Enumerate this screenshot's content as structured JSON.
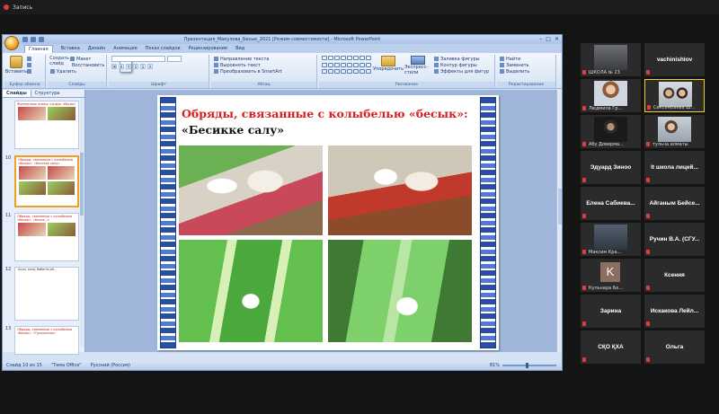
{
  "recording": {
    "label": "Запись"
  },
  "ppt": {
    "window_title": "Презентация_Макулова_Бесык_2021 [Режим совместимости] - Microsoft PowerPoint",
    "tabs": [
      "Главная",
      "Вставка",
      "Дизайн",
      "Анимация",
      "Показ слайдов",
      "Рецензирование",
      "Вид"
    ],
    "ribbon": {
      "clipboard": {
        "paste": "Вставить",
        "label": "Буфер обмена"
      },
      "slides": {
        "new_slide": "Создать слайд",
        "layout": "Макет",
        "reset": "Восстановить",
        "delete": "Удалить",
        "label": "Слайды"
      },
      "font": {
        "label": "Шрифт"
      },
      "paragraph": {
        "direction": "Направление текста",
        "align": "Выровнять текст",
        "smartart": "Преобразовать в SmartArt",
        "label": "Абзац"
      },
      "drawing": {
        "arrange": "Упорядочить",
        "quick_styles": "Экспресс-стили",
        "fill": "Заливка фигуры",
        "outline": "Контур фигуры",
        "effects": "Эффекты для фигур",
        "label": "Рисование"
      },
      "editing": {
        "find": "Найти",
        "replace": "Заменить",
        "select": "Выделить",
        "label": "Редактирование"
      }
    },
    "panel_tabs": [
      "Слайды",
      "Структура"
    ],
    "thumbnails": [
      {
        "num": "",
        "title": "Жизненные этапы: сундук «бесик»"
      },
      {
        "num": "10",
        "title": "Обряды, связанные с колыбелью «бесык»: «Бесикке салу»"
      },
      {
        "num": "11",
        "title": "Обряды, связанные с колыбелью «бесык»: «Бесик...»"
      },
      {
        "num": "12",
        "text": "Алли, алли, бөбегім-ай..."
      },
      {
        "num": "13",
        "title": "Обряды, связанные с колыбелью «бесык»: «Тұсаукесер»"
      }
    ],
    "slide": {
      "title": "Обряды, связанные с колыбелью «бесык»:",
      "subtitle": "«Бесикке салу»"
    },
    "status": {
      "slide_of": "Слайд 10 из 15",
      "theme": "\"Тема Office\"",
      "language": "Русский (Россия)",
      "zoom": "81%"
    }
  },
  "participants": [
    {
      "name": "ШКОЛА № 23",
      "type": "video"
    },
    {
      "name": "vachinishlov",
      "type": "name"
    },
    {
      "name": "Людмила Гр...",
      "type": "video"
    },
    {
      "name": "Сексембаева Ш...",
      "type": "video"
    },
    {
      "name": "Абу Доверма...",
      "type": "video"
    },
    {
      "name": "тульча алматы",
      "type": "video"
    },
    {
      "name": "Эдуард Зиноо",
      "type": "name"
    },
    {
      "name": "It школа лицей...",
      "type": "name"
    },
    {
      "name": "Елена Сабиева...",
      "type": "name"
    },
    {
      "name": "Айганым Бейсе...",
      "type": "name"
    },
    {
      "name": "Максим Кра...",
      "type": "video"
    },
    {
      "name": "Ручин В.А. (СГУ...",
      "type": "name"
    },
    {
      "name": "Кульнара Бе...",
      "type": "initial",
      "initial": "K"
    },
    {
      "name": "Ксения",
      "type": "name"
    },
    {
      "name": "Зарина",
      "type": "name"
    },
    {
      "name": "Искакова Лейл...",
      "type": "name"
    },
    {
      "name": "СҚО ҚХА",
      "type": "name"
    },
    {
      "name": "Ольга",
      "type": "name"
    }
  ]
}
